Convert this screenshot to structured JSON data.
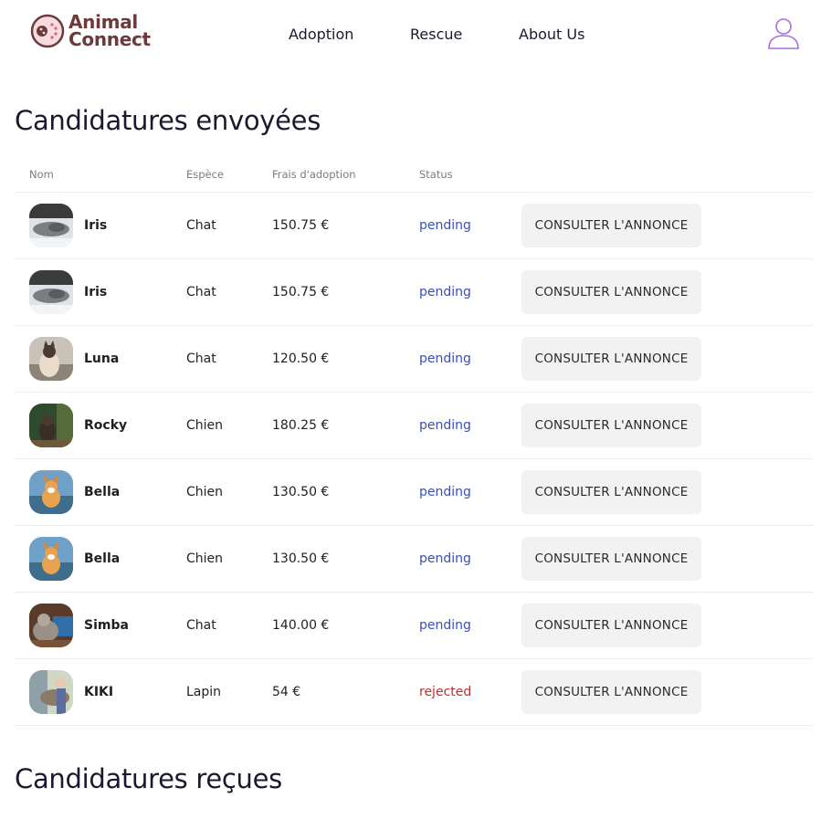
{
  "brand": {
    "line1": "Animal",
    "line2": "Connect",
    "color": "#6b3b3b"
  },
  "nav": {
    "adoption": "Adoption",
    "rescue": "Rescue",
    "about": "About Us"
  },
  "sections": {
    "sent_title": "Candidatures envoyées",
    "received_title": "Candidatures reçues"
  },
  "table": {
    "headers": {
      "name": "Nom",
      "species": "Espèce",
      "fee": "Frais d'adoption",
      "status": "Status"
    },
    "button_label": "CONSULTER L'ANNONCE",
    "rows": [
      {
        "name": "Iris",
        "species": "Chat",
        "fee": "150.75 €",
        "status": "pending",
        "photo": "cat-grey-lying"
      },
      {
        "name": "Iris",
        "species": "Chat",
        "fee": "150.75 €",
        "status": "pending",
        "photo": "cat-grey-lying"
      },
      {
        "name": "Luna",
        "species": "Chat",
        "fee": "120.50 €",
        "status": "pending",
        "photo": "cat-siamese"
      },
      {
        "name": "Rocky",
        "species": "Chien",
        "fee": "180.25 €",
        "status": "pending",
        "photo": "dog-forest"
      },
      {
        "name": "Bella",
        "species": "Chien",
        "fee": "130.50 €",
        "status": "pending",
        "photo": "dog-corgi"
      },
      {
        "name": "Bella",
        "species": "Chien",
        "fee": "130.50 €",
        "status": "pending",
        "photo": "dog-corgi"
      },
      {
        "name": "Simba",
        "species": "Chat",
        "fee": "140.00 €",
        "status": "pending",
        "photo": "cat-tabby"
      },
      {
        "name": "KIKI",
        "species": "Lapin",
        "fee": "54 €",
        "status": "rejected",
        "photo": "rabbit-held"
      }
    ]
  },
  "colors": {
    "pending": "#3a4fb5",
    "rejected": "#b3322e",
    "button_bg": "#f2f2f2",
    "user_icon": "#a86ce0"
  }
}
